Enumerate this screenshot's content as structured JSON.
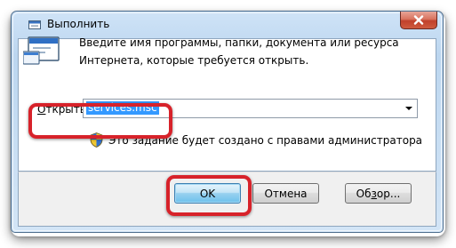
{
  "window": {
    "title": "Выполнить"
  },
  "dialog": {
    "description_line1": "Введите имя программы, папки, документа или ресурса",
    "description_line2": "Интернета, которые требуется открыть.",
    "open_label_underlined": "О",
    "open_label_rest": "ткрыть:",
    "open_value": "services.msc",
    "admin_note": "Это задание будет создано с правами администратора"
  },
  "buttons": {
    "ok": "OK",
    "cancel": "Отмена",
    "browse_prefix": "Об",
    "browse_underlined": "з",
    "browse_suffix": "ор..."
  },
  "icons": {
    "title": "run-dialog-small-icon",
    "main": "run-dialog-icon",
    "shield": "uac-shield-icon",
    "close": "close-icon",
    "dropdown": "chevron-down-icon"
  },
  "colors": {
    "highlight": "#d7222a",
    "selection": "#3399ff",
    "close_button": "#c0412b"
  }
}
